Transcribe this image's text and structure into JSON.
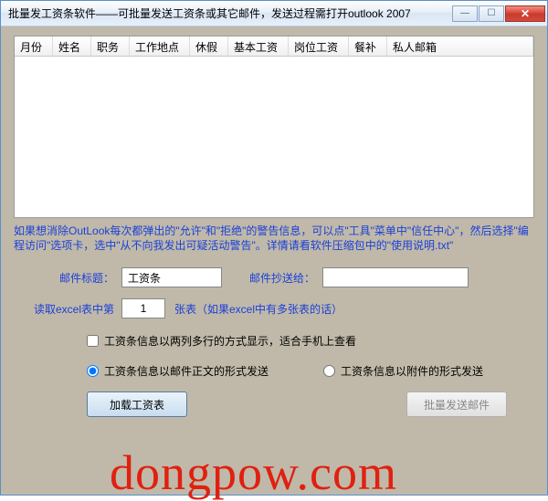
{
  "window": {
    "title": "批量发工资条软件——可批量发送工资条或其它邮件，发送过程需打开outlook 2007"
  },
  "grid": {
    "columns": [
      "月份",
      "姓名",
      "职务",
      "工作地点",
      "休假",
      "基本工资",
      "岗位工资",
      "餐补",
      "私人邮箱"
    ]
  },
  "hint": "如果想消除OutLook每次都弹出的\"允许\"和\"拒绝\"的警告信息，可以点\"工具\"菜单中\"信任中心\"，然后选择\"编程访问\"选项卡，选中\"从不向我发出可疑活动警告\"。详情请看软件压缩包中的\"使用说明.txt\"",
  "form": {
    "subject_label": "邮件标题：",
    "subject_value": "工资条",
    "cc_label": "邮件抄送给：",
    "cc_value": "",
    "sheet_prefix": "读取excel表中第",
    "sheet_value": "1",
    "sheet_suffix": "张表（如果excel中有多张表的话）",
    "checkbox_label": "工资条信息以两列多行的方式显示，适合手机上查看",
    "radio_body": "工资条信息以邮件正文的形式发送",
    "radio_attach": "工资条信息以附件的形式发送"
  },
  "buttons": {
    "load": "加载工资表",
    "send": "批量发送邮件"
  },
  "watermark": "dongpow.com"
}
